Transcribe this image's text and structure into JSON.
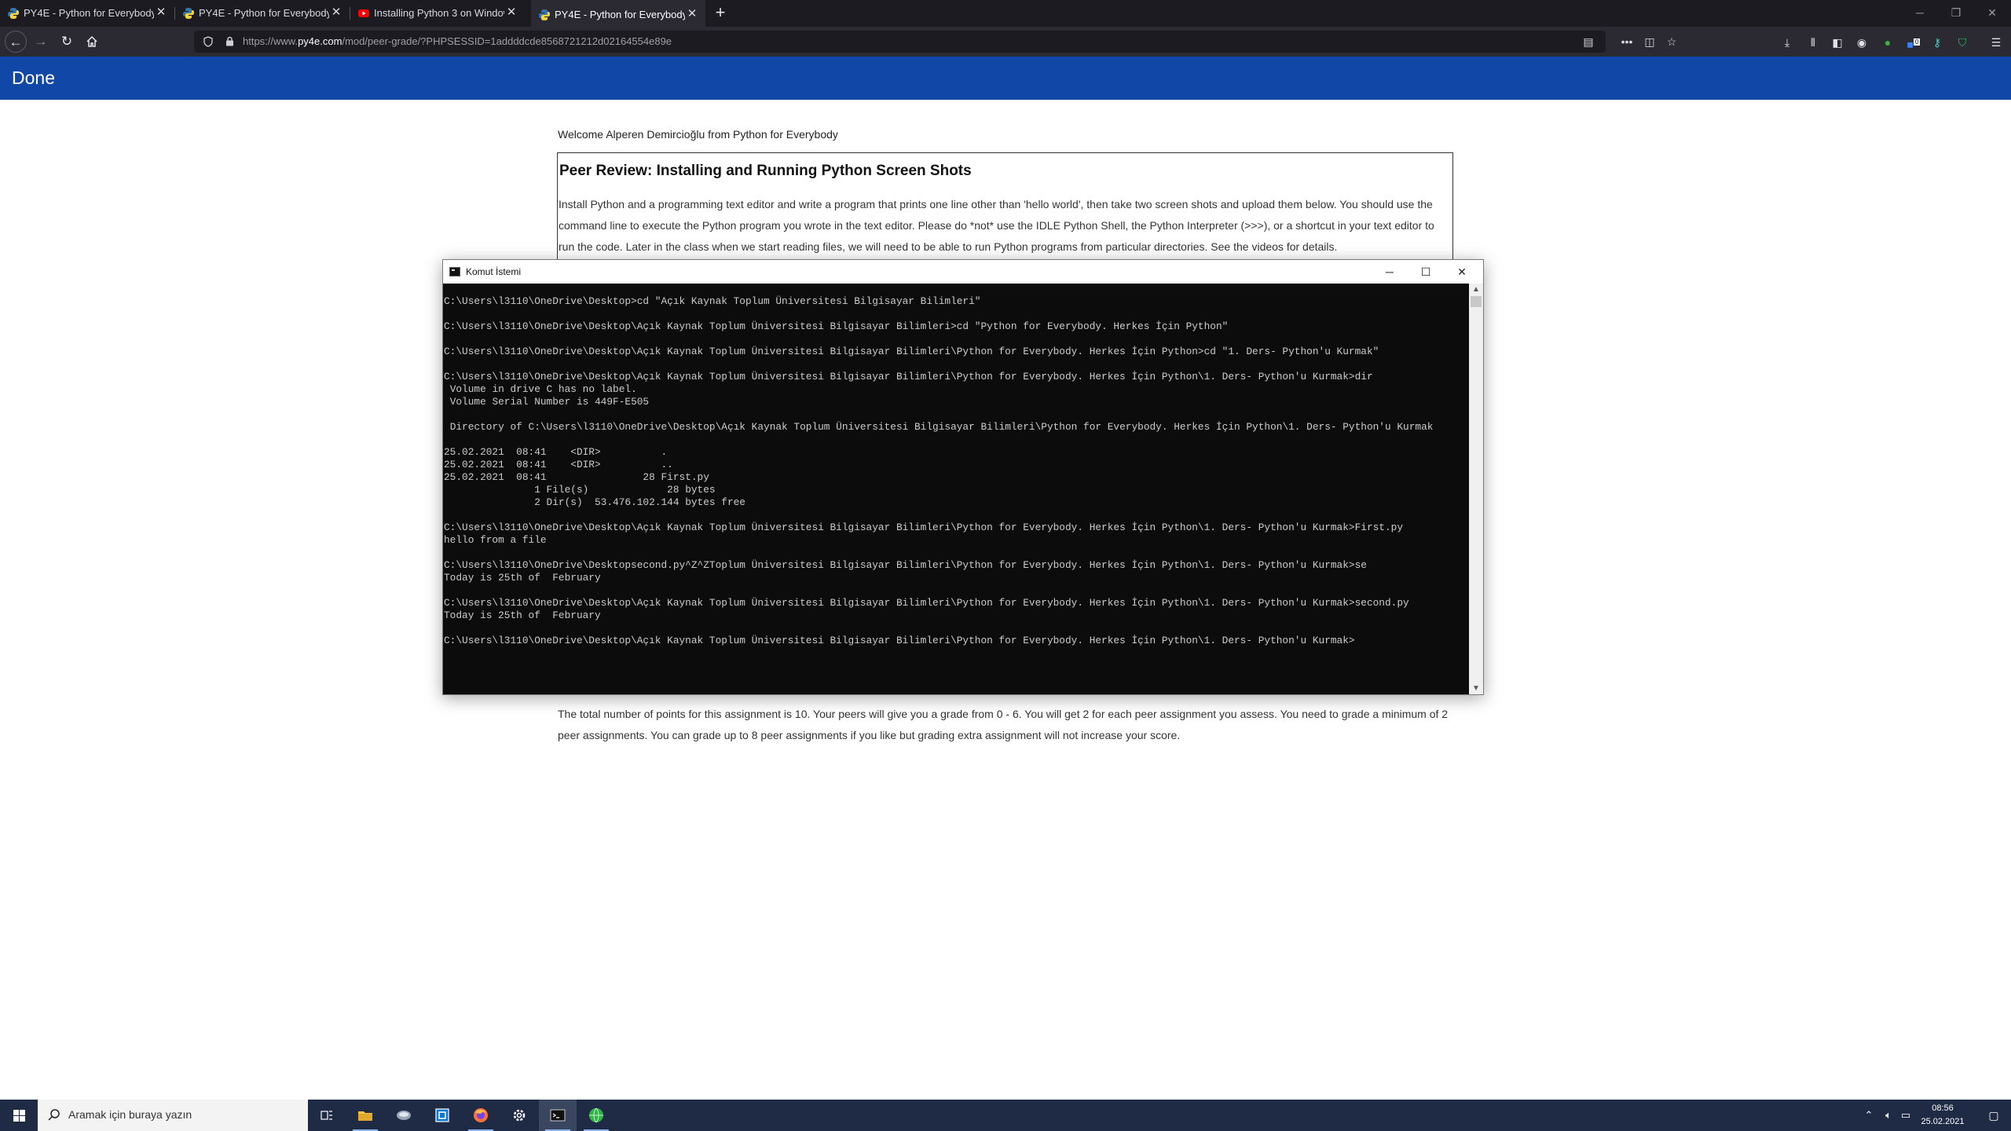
{
  "browser": {
    "tabs": [
      {
        "label": "PY4E - Python for Everybody",
        "icon": "python-favicon",
        "active": false
      },
      {
        "label": "PY4E - Python for Everybody",
        "icon": "python-favicon",
        "active": false
      },
      {
        "label": "Installing Python 3 on Window",
        "icon": "youtube-favicon",
        "active": false
      },
      {
        "label": "PY4E - Python for Everybody",
        "icon": "python-favicon",
        "active": true
      }
    ],
    "new_tab": "+",
    "url_prefix": "https://www.",
    "url_domain": "py4e.com",
    "url_rest": "/mod/peer-grade/?PHPSESSID=1addddcde8568721212d02164554e89e",
    "extension_badge": "0"
  },
  "app": {
    "done_label": "Done"
  },
  "page": {
    "welcome": "Welcome Alperen Demircioğlu from Python for Everybody",
    "title": "Peer Review: Installing and Running Python Screen Shots",
    "instructions": "Install Python and a programming text editor and write a program that prints one line other than 'hello world', then take two screen shots and upload them below. You should use the command line to execute the Python program you wrote in the text editor. Please do *not* use the IDLE Python Shell, the Python Interpreter (>>>), or a shortcut in your text editor to run the code. Later in the class when we start reading files, we will need to be able to run Python programs from particular directories. See the videos for details.",
    "grading": "The total number of points for this assignment is 10. Your peers will give you a grade from 0 - 6. You will get 2 for each peer assignment you assess. You need to grade a minimum of 2 peer assignments. You can grade up to 8 peer assignments if you like but grading extra assignment will not increase your score."
  },
  "console": {
    "title": "Komut İstemi",
    "output": "C:\\Users\\l3110\\OneDrive\\Desktop>cd \"Açık Kaynak Toplum Üniversitesi Bilgisayar Bilimleri\"\n\nC:\\Users\\l3110\\OneDrive\\Desktop\\Açık Kaynak Toplum Üniversitesi Bilgisayar Bilimleri>cd \"Python for Everybody. Herkes İçin Python\"\n\nC:\\Users\\l3110\\OneDrive\\Desktop\\Açık Kaynak Toplum Üniversitesi Bilgisayar Bilimleri\\Python for Everybody. Herkes İçin Python>cd \"1. Ders- Python'u Kurmak\"\n\nC:\\Users\\l3110\\OneDrive\\Desktop\\Açık Kaynak Toplum Üniversitesi Bilgisayar Bilimleri\\Python for Everybody. Herkes İçin Python\\1. Ders- Python'u Kurmak>dir\n Volume in drive C has no label.\n Volume Serial Number is 449F-E505\n\n Directory of C:\\Users\\l3110\\OneDrive\\Desktop\\Açık Kaynak Toplum Üniversitesi Bilgisayar Bilimleri\\Python for Everybody. Herkes İçin Python\\1. Ders- Python'u Kurmak\n\n25.02.2021  08:41    <DIR>          .\n25.02.2021  08:41    <DIR>          ..\n25.02.2021  08:41                28 First.py\n               1 File(s)             28 bytes\n               2 Dir(s)  53.476.102.144 bytes free\n\nC:\\Users\\l3110\\OneDrive\\Desktop\\Açık Kaynak Toplum Üniversitesi Bilgisayar Bilimleri\\Python for Everybody. Herkes İçin Python\\1. Ders- Python'u Kurmak>First.py\nhello from a file\n\nC:\\Users\\l3110\\OneDrive\\Desktopsecond.py^Z^ZToplum Üniversitesi Bilgisayar Bilimleri\\Python for Everybody. Herkes İçin Python\\1. Ders- Python'u Kurmak>se\nToday is 25th of  February\n\nC:\\Users\\l3110\\OneDrive\\Desktop\\Açık Kaynak Toplum Üniversitesi Bilgisayar Bilimleri\\Python for Everybody. Herkes İçin Python\\1. Ders- Python'u Kurmak>second.py\nToday is 25th of  February\n\nC:\\Users\\l3110\\OneDrive\\Desktop\\Açık Kaynak Toplum Üniversitesi Bilgisayar Bilimleri\\Python for Everybody. Herkes İçin Python\\1. Ders- Python'u Kurmak>"
  },
  "taskbar": {
    "search_placeholder": "Aramak için buraya yazın",
    "apps": [
      "task-view-icon",
      "file-explorer-icon",
      "app-icon",
      "store-icon",
      "firefox-icon",
      "settings-icon",
      "command-prompt-icon",
      "globe-app-icon"
    ],
    "time": "08:56",
    "date": "25.02.2021"
  },
  "colors": {
    "app_header": "#1148a8",
    "browser_chrome": "#2b2a33",
    "taskbar": "#1f2a44",
    "console_bg": "#0c0c0c"
  }
}
